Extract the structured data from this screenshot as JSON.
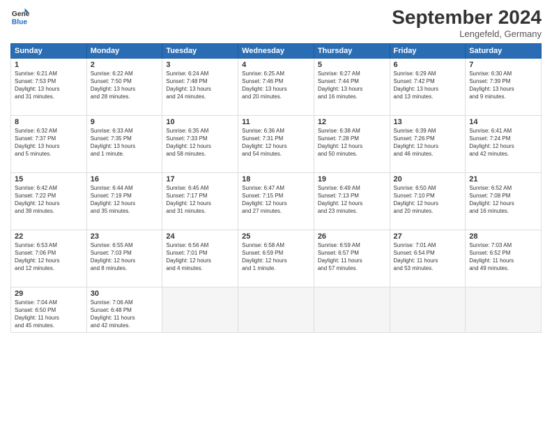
{
  "header": {
    "logo_line1": "General",
    "logo_line2": "Blue",
    "month_title": "September 2024",
    "location": "Lengefeld, Germany"
  },
  "weekdays": [
    "Sunday",
    "Monday",
    "Tuesday",
    "Wednesday",
    "Thursday",
    "Friday",
    "Saturday"
  ],
  "days": [
    {
      "num": "",
      "info": ""
    },
    {
      "num": "",
      "info": ""
    },
    {
      "num": "",
      "info": ""
    },
    {
      "num": "",
      "info": ""
    },
    {
      "num": "",
      "info": ""
    },
    {
      "num": "",
      "info": ""
    },
    {
      "num": "",
      "info": ""
    },
    {
      "num": "1",
      "info": "Sunrise: 6:21 AM\nSunset: 7:53 PM\nDaylight: 13 hours\nand 31 minutes."
    },
    {
      "num": "2",
      "info": "Sunrise: 6:22 AM\nSunset: 7:50 PM\nDaylight: 13 hours\nand 28 minutes."
    },
    {
      "num": "3",
      "info": "Sunrise: 6:24 AM\nSunset: 7:48 PM\nDaylight: 13 hours\nand 24 minutes."
    },
    {
      "num": "4",
      "info": "Sunrise: 6:25 AM\nSunset: 7:46 PM\nDaylight: 13 hours\nand 20 minutes."
    },
    {
      "num": "5",
      "info": "Sunrise: 6:27 AM\nSunset: 7:44 PM\nDaylight: 13 hours\nand 16 minutes."
    },
    {
      "num": "6",
      "info": "Sunrise: 6:29 AM\nSunset: 7:42 PM\nDaylight: 13 hours\nand 13 minutes."
    },
    {
      "num": "7",
      "info": "Sunrise: 6:30 AM\nSunset: 7:39 PM\nDaylight: 13 hours\nand 9 minutes."
    },
    {
      "num": "8",
      "info": "Sunrise: 6:32 AM\nSunset: 7:37 PM\nDaylight: 13 hours\nand 5 minutes."
    },
    {
      "num": "9",
      "info": "Sunrise: 6:33 AM\nSunset: 7:35 PM\nDaylight: 13 hours\nand 1 minute."
    },
    {
      "num": "10",
      "info": "Sunrise: 6:35 AM\nSunset: 7:33 PM\nDaylight: 12 hours\nand 58 minutes."
    },
    {
      "num": "11",
      "info": "Sunrise: 6:36 AM\nSunset: 7:31 PM\nDaylight: 12 hours\nand 54 minutes."
    },
    {
      "num": "12",
      "info": "Sunrise: 6:38 AM\nSunset: 7:28 PM\nDaylight: 12 hours\nand 50 minutes."
    },
    {
      "num": "13",
      "info": "Sunrise: 6:39 AM\nSunset: 7:26 PM\nDaylight: 12 hours\nand 46 minutes."
    },
    {
      "num": "14",
      "info": "Sunrise: 6:41 AM\nSunset: 7:24 PM\nDaylight: 12 hours\nand 42 minutes."
    },
    {
      "num": "15",
      "info": "Sunrise: 6:42 AM\nSunset: 7:22 PM\nDaylight: 12 hours\nand 39 minutes."
    },
    {
      "num": "16",
      "info": "Sunrise: 6:44 AM\nSunset: 7:19 PM\nDaylight: 12 hours\nand 35 minutes."
    },
    {
      "num": "17",
      "info": "Sunrise: 6:45 AM\nSunset: 7:17 PM\nDaylight: 12 hours\nand 31 minutes."
    },
    {
      "num": "18",
      "info": "Sunrise: 6:47 AM\nSunset: 7:15 PM\nDaylight: 12 hours\nand 27 minutes."
    },
    {
      "num": "19",
      "info": "Sunrise: 6:49 AM\nSunset: 7:13 PM\nDaylight: 12 hours\nand 23 minutes."
    },
    {
      "num": "20",
      "info": "Sunrise: 6:50 AM\nSunset: 7:10 PM\nDaylight: 12 hours\nand 20 minutes."
    },
    {
      "num": "21",
      "info": "Sunrise: 6:52 AM\nSunset: 7:08 PM\nDaylight: 12 hours\nand 16 minutes."
    },
    {
      "num": "22",
      "info": "Sunrise: 6:53 AM\nSunset: 7:06 PM\nDaylight: 12 hours\nand 12 minutes."
    },
    {
      "num": "23",
      "info": "Sunrise: 6:55 AM\nSunset: 7:03 PM\nDaylight: 12 hours\nand 8 minutes."
    },
    {
      "num": "24",
      "info": "Sunrise: 6:56 AM\nSunset: 7:01 PM\nDaylight: 12 hours\nand 4 minutes."
    },
    {
      "num": "25",
      "info": "Sunrise: 6:58 AM\nSunset: 6:59 PM\nDaylight: 12 hours\nand 1 minute."
    },
    {
      "num": "26",
      "info": "Sunrise: 6:59 AM\nSunset: 6:57 PM\nDaylight: 11 hours\nand 57 minutes."
    },
    {
      "num": "27",
      "info": "Sunrise: 7:01 AM\nSunset: 6:54 PM\nDaylight: 11 hours\nand 53 minutes."
    },
    {
      "num": "28",
      "info": "Sunrise: 7:03 AM\nSunset: 6:52 PM\nDaylight: 11 hours\nand 49 minutes."
    },
    {
      "num": "29",
      "info": "Sunrise: 7:04 AM\nSunset: 6:50 PM\nDaylight: 11 hours\nand 45 minutes."
    },
    {
      "num": "30",
      "info": "Sunrise: 7:06 AM\nSunset: 6:48 PM\nDaylight: 11 hours\nand 42 minutes."
    },
    {
      "num": "",
      "info": ""
    },
    {
      "num": "",
      "info": ""
    },
    {
      "num": "",
      "info": ""
    },
    {
      "num": "",
      "info": ""
    },
    {
      "num": "",
      "info": ""
    }
  ]
}
